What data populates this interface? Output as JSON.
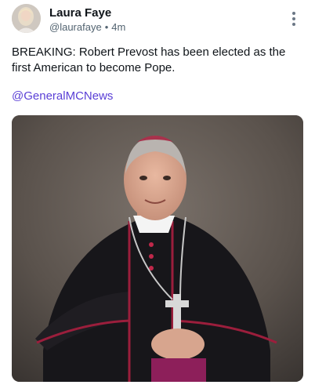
{
  "author": {
    "display_name": "Laura Faye",
    "handle": "@laurafaye",
    "separator": "•",
    "time_ago": "4m"
  },
  "post": {
    "text": "BREAKING: Robert Prevost has been elected as the first American to become Pope.",
    "mention": "@GeneralMCNews"
  },
  "media": {
    "description_icon": "photo"
  },
  "colors": {
    "link": "#5a3fd6",
    "muted": "#536471",
    "text": "#0f1419"
  }
}
